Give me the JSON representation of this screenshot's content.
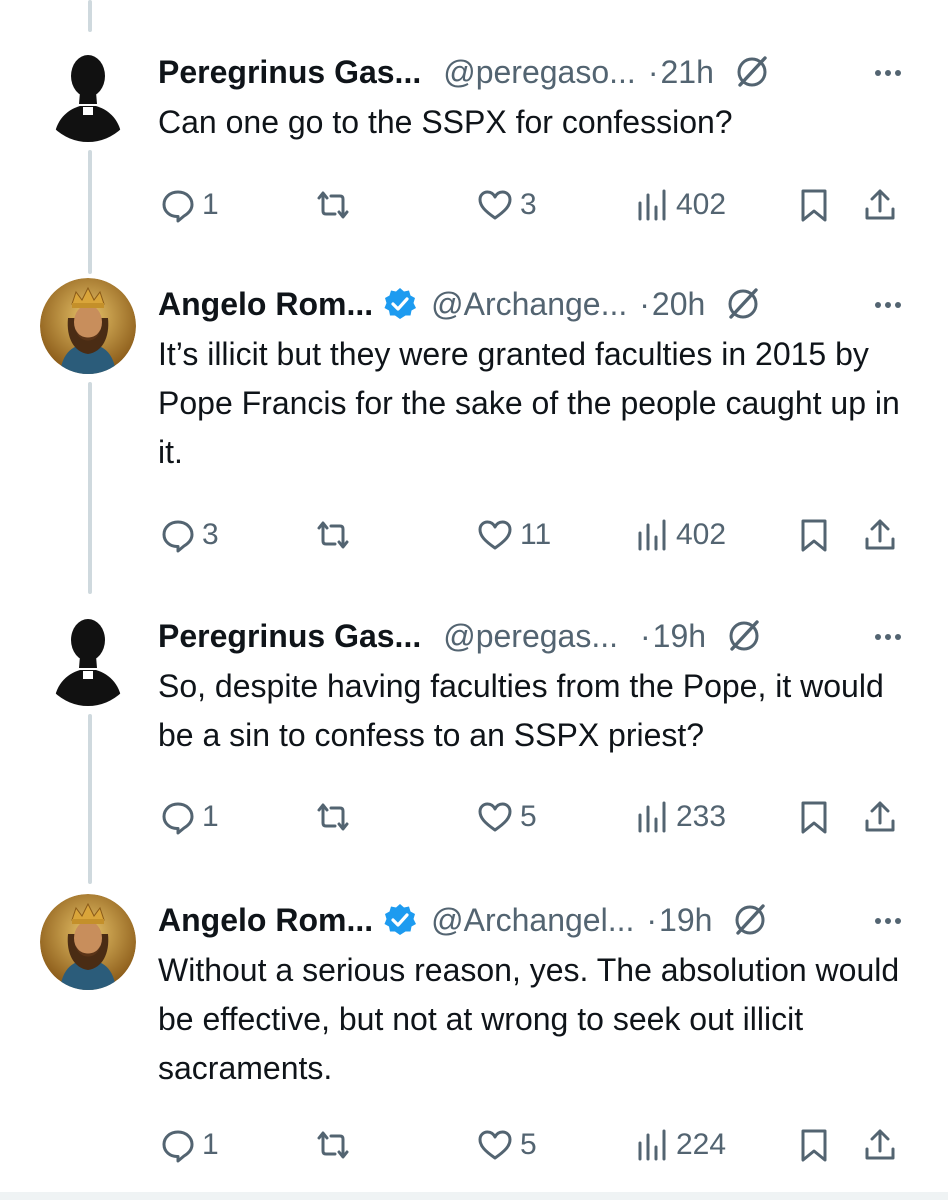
{
  "tweets": [
    {
      "name": "Peregrinus Gas...",
      "handle": "@peregaso...",
      "separator": "·",
      "time": "21h",
      "verified": false,
      "avatar_icon": "clergy-silhouette-icon",
      "text": "Can one go to the SSPX for confession?",
      "replies": "1",
      "retweets": "",
      "likes": "3",
      "views": "402"
    },
    {
      "name": "Angelo Rom...",
      "handle": "@Archange...",
      "separator": "·",
      "time": "20h",
      "verified": true,
      "avatar_icon": "king-portrait-icon",
      "text": "It’s illicit but they were granted faculties in 2015 by Pope Francis for the sake of the people caught up in it.",
      "replies": "3",
      "retweets": "",
      "likes": "11",
      "views": "402"
    },
    {
      "name": "Peregrinus Gas...",
      "handle": "@peregas...",
      "separator": "·",
      "time": "19h",
      "verified": false,
      "avatar_icon": "clergy-silhouette-icon",
      "text": "So, despite having faculties from the Pope, it would be a sin to confess to an SSPX priest?",
      "replies": "1",
      "retweets": "",
      "likes": "5",
      "views": "233"
    },
    {
      "name": "Angelo Rom...",
      "handle": "@Archangel...",
      "separator": "·",
      "time": "19h",
      "verified": true,
      "avatar_icon": "king-portrait-icon",
      "text": "Without a serious reason, yes. The absolution would be effective, but not at wrong to seek out illicit sacraments.",
      "replies": "1",
      "retweets": "",
      "likes": "5",
      "views": "224"
    }
  ],
  "colors": {
    "text": "#0f1419",
    "muted": "#536471",
    "verified": "#1d9bf0",
    "thread_line": "#cfd9de"
  }
}
